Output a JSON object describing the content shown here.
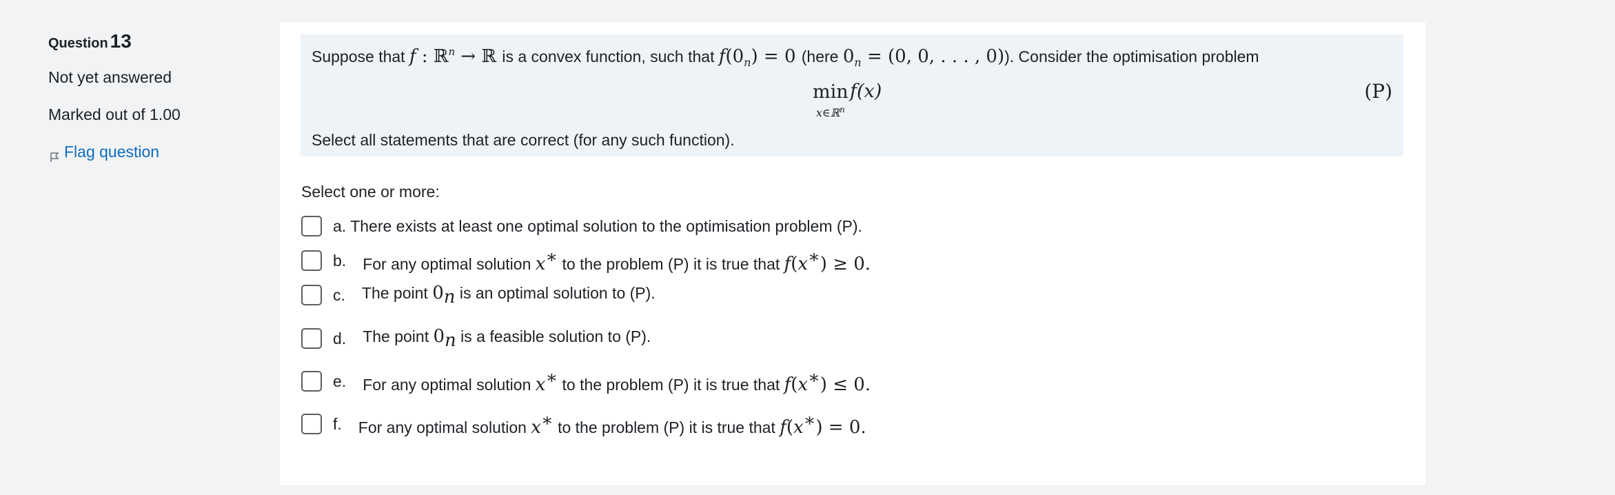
{
  "info": {
    "question_label": "Question",
    "question_number": "13",
    "state": "Not yet answered",
    "grade": "Marked out of 1.00",
    "flag_label": "Flag question"
  },
  "question": {
    "intro": "Suppose that",
    "text_1": "is a convex function, such that",
    "text_2": "(here",
    "text_3": "). Consider the optimisation problem",
    "min": "min",
    "min_sub": "x∈ℝ",
    "equation_tag": "(P)",
    "instruction": "Select all statements that are correct (for any such function)."
  },
  "prompt": "Select one or more:",
  "options": [
    {
      "letter": "a.",
      "text": "There exists at least one optimal solution to the optimisation problem (P).",
      "checked": false
    },
    {
      "letter": "b.",
      "text_pre": "For any optimal solution",
      "text_mid": "to the problem (P) it is true that",
      "relation": "≥ 0.",
      "checked": false
    },
    {
      "letter": "c.",
      "text_pre": "The point",
      "text_post": "is an optimal solution to (P).",
      "checked": false
    },
    {
      "letter": "d.",
      "text_pre": "The point",
      "text_post": "is a feasible solution to (P).",
      "checked": false
    },
    {
      "letter": "e.",
      "text_pre": "For any optimal solution",
      "text_mid": "to the problem (P) it is true that",
      "relation": "≤ 0.",
      "checked": false
    },
    {
      "letter": "f.",
      "text_pre": "For any optimal solution",
      "text_mid": "to the problem (P) it is true that",
      "relation": "= 0.",
      "checked": false
    }
  ],
  "colors": {
    "page_bg": "#f2f3f4",
    "formulation_bg": "#eef3f8",
    "link": "#0f6cbf",
    "text": "#1d2125"
  }
}
